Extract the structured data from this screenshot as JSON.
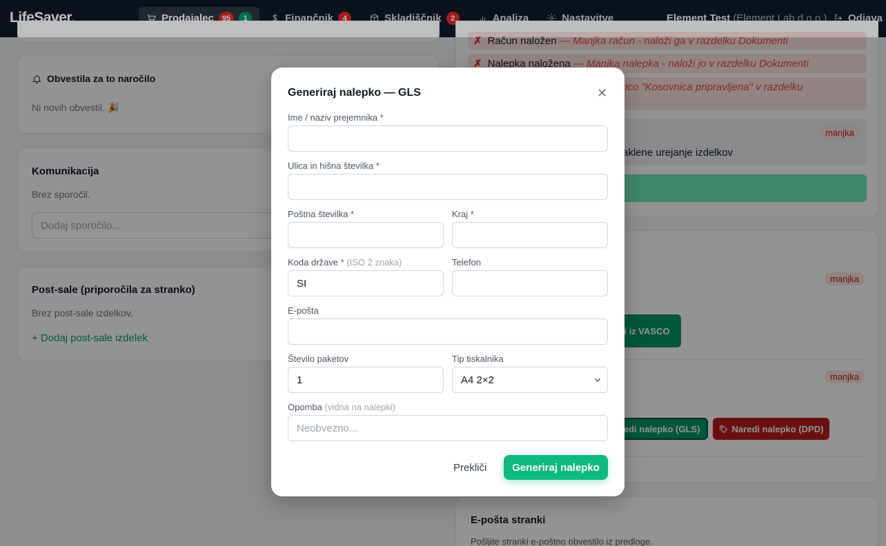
{
  "app": {
    "logo_text": "LifeSaver",
    "logo_dot": "."
  },
  "nav": {
    "prodajalec": {
      "label": "Prodajalec",
      "badge_red": "95",
      "badge_green": "1"
    },
    "financnik": {
      "label": "Finančnik",
      "badge": "4"
    },
    "skladiscnik": {
      "label": "Skladiščnik",
      "badge": "2"
    },
    "analiza": {
      "label": "Analiza"
    },
    "nastavitve": {
      "label": "Nastavitve"
    }
  },
  "user": {
    "name": "Element Test",
    "org": "(Element Lab d.o.o.)"
  },
  "logout_label": "Odjava",
  "left": {
    "notifications": {
      "title": "Obvestila za to naročilo",
      "empty": "Ni novih obvestil. 🎉"
    },
    "communication": {
      "title": "Komunikacija",
      "empty": "Brez sporočil.",
      "placeholder": "Dodaj sporočilo..."
    },
    "postsale": {
      "title": "Post-sale (priporočila za stranko)",
      "empty": "Brez post-sale izdelkov.",
      "add_label": "+ Dodaj post-sale izdelek"
    }
  },
  "right": {
    "errors": [
      {
        "label": "Račun naložen",
        "note": "— Manjka račun - naloži ga v razdelku Dokumenti"
      },
      {
        "label": "Nalepka naložena",
        "note": "— Manjka nalepka - naloži jo v razdelku Dokumenti"
      },
      {
        "label": "",
        "note": "kljukico \"Kosovnica pripravljena\" v razdelku"
      }
    ],
    "manjka": "manjka",
    "checklist_text": "aklene urejanje izdelkov",
    "vasco_button": "bi iz VASCO",
    "gls_button": "aredi nalepko (GLS)",
    "dpd_button": "Naredi nalepko (DPD)",
    "email": {
      "title": "E-pošta stranki",
      "desc": "Pošljite stranki e-poštno obvestilo iz predloge."
    }
  },
  "modal": {
    "title": "Generiraj nalepko — GLS",
    "fields": {
      "name": {
        "label": "Ime / naziv prejemnika *",
        "value": ""
      },
      "street": {
        "label": "Ulica in hišna številka *",
        "value": ""
      },
      "postal": {
        "label": "Poštna številka *",
        "value": ""
      },
      "city": {
        "label": "Kraj *",
        "value": ""
      },
      "country": {
        "label": "Koda države *",
        "hint": "(ISO 2 znaka)",
        "value": "SI"
      },
      "phone": {
        "label": "Telefon",
        "value": ""
      },
      "email": {
        "label": "E-pošta",
        "value": ""
      },
      "packages": {
        "label": "Število paketov",
        "value": "1"
      },
      "printer": {
        "label": "Tip tiskalnika",
        "value": "A4 2×2"
      },
      "note": {
        "label": "Opomba",
        "hint": "(vidna na nalepki)",
        "placeholder": "Neobvezno..."
      }
    },
    "cancel": "Prekliči",
    "submit": "Generiraj nalepko"
  }
}
